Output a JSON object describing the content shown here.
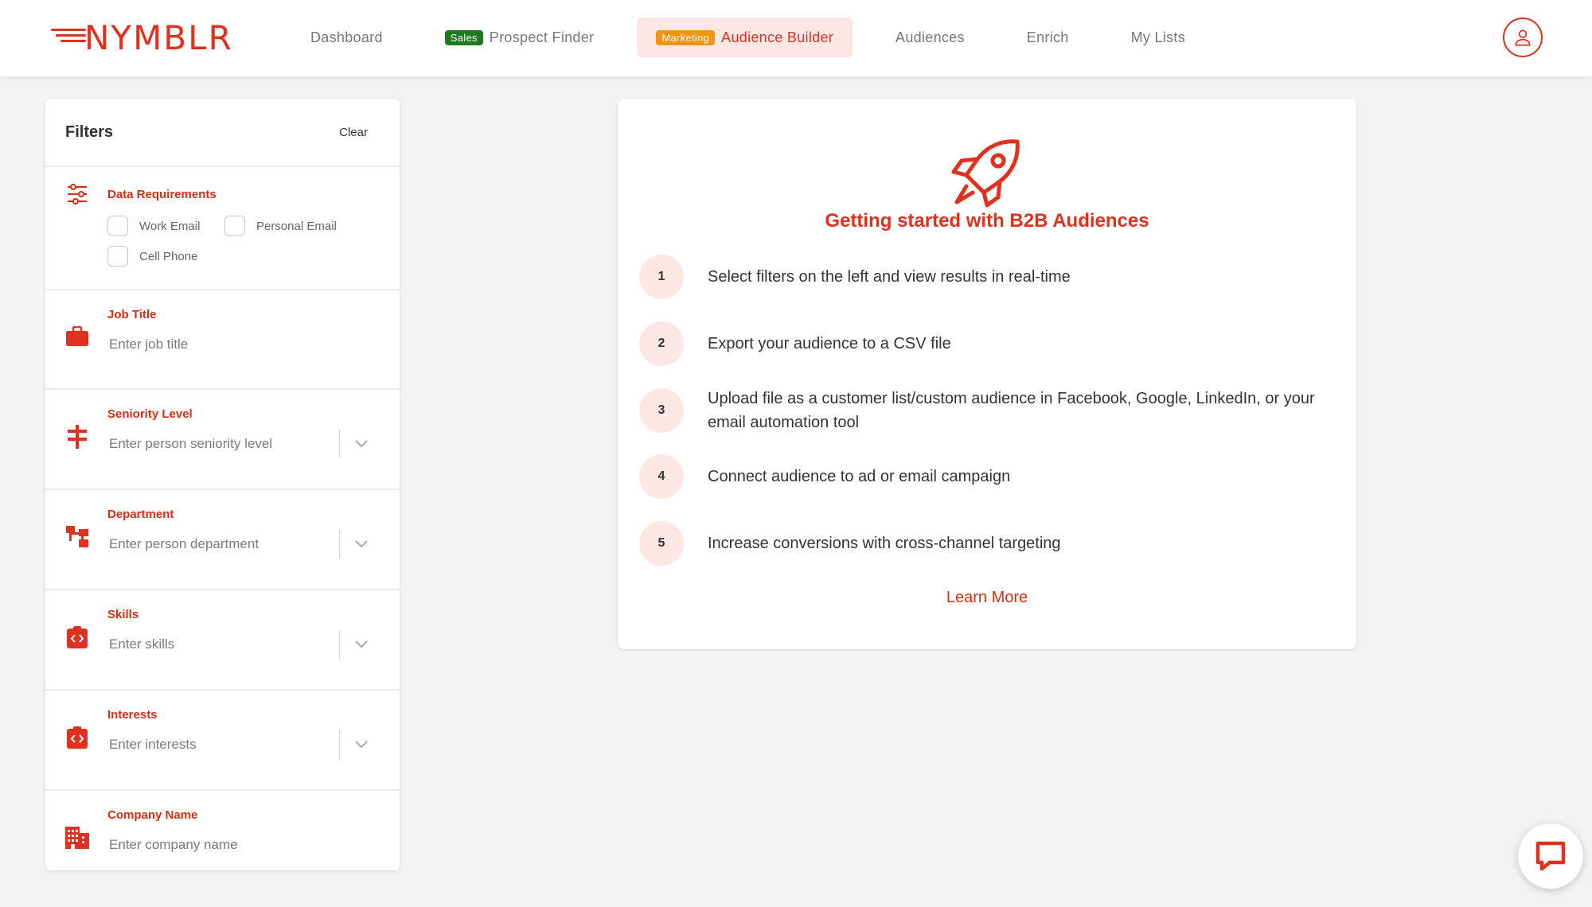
{
  "brand": {
    "name": "NYMBLR",
    "color": "#e0301e"
  },
  "nav": {
    "dashboard": "Dashboard",
    "prospect_finder": {
      "badge": "Sales",
      "label": "Prospect Finder"
    },
    "audience_builder": {
      "badge": "Marketing",
      "label": "Audience Builder"
    },
    "audiences": "Audiences",
    "enrich": "Enrich",
    "my_lists": "My Lists"
  },
  "sidebar": {
    "title": "Filters",
    "clear": "Clear",
    "data_requirements": {
      "label": "Data Requirements",
      "work_email": "Work Email",
      "personal_email": "Personal Email",
      "cell_phone": "Cell Phone"
    },
    "job_title": {
      "label": "Job Title",
      "placeholder": "Enter job title"
    },
    "seniority": {
      "label": "Seniority Level",
      "placeholder": "Enter person seniority level"
    },
    "department": {
      "label": "Department",
      "placeholder": "Enter person department"
    },
    "skills": {
      "label": "Skills",
      "placeholder": "Enter skills"
    },
    "interests": {
      "label": "Interests",
      "placeholder": "Enter interests"
    },
    "company": {
      "label": "Company Name",
      "placeholder": "Enter company name"
    }
  },
  "main": {
    "title": "Getting started with B2B Audiences",
    "steps": [
      {
        "num": "1",
        "text": "Select filters on the left and view results in real-time"
      },
      {
        "num": "2",
        "text": "Export your audience to a CSV file"
      },
      {
        "num": "3",
        "text": "Upload file as a customer list/custom audience in Facebook, Google, LinkedIn, or your email automation tool"
      },
      {
        "num": "4",
        "text": "Connect audience to ad or email campaign"
      },
      {
        "num": "5",
        "text": "Increase conversions with cross-channel targeting"
      }
    ],
    "learn_more": "Learn More"
  }
}
